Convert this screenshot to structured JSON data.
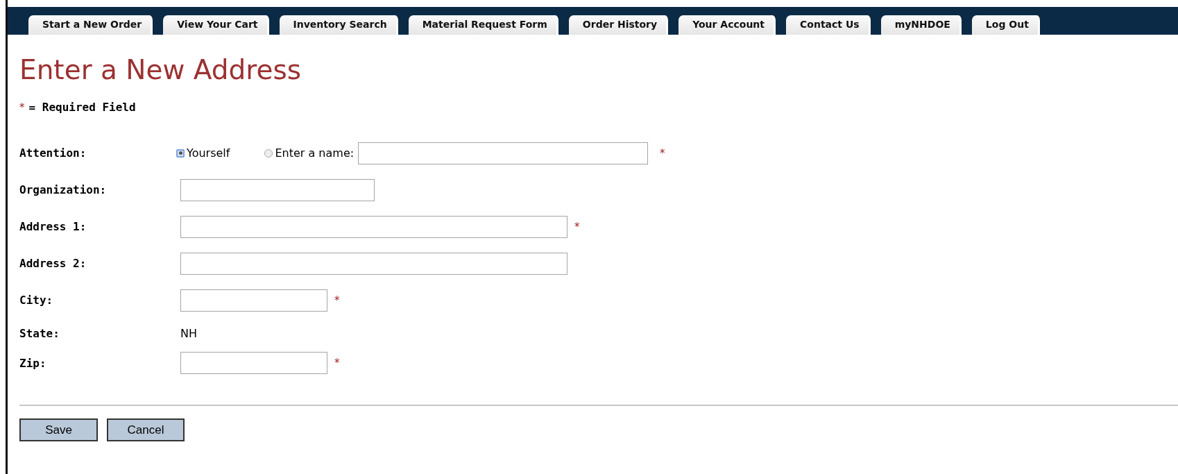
{
  "tabs": [
    {
      "label": "Start a New Order"
    },
    {
      "label": "View Your Cart"
    },
    {
      "label": "Inventory Search"
    },
    {
      "label": "Material Request Form"
    },
    {
      "label": "Order History"
    },
    {
      "label": "Your Account"
    },
    {
      "label": "Contact Us"
    },
    {
      "label": "myNHDOE"
    },
    {
      "label": "Log Out"
    }
  ],
  "title": "Enter a New Address",
  "legend": {
    "mark": "*",
    "text": "= Required Field"
  },
  "fields": [
    {
      "kind": "radio",
      "label": "Attention:",
      "options": [
        {
          "label": "Yourself",
          "selected": true
        },
        {
          "label": "Enter a name:",
          "selected": false
        }
      ],
      "required": true
    },
    {
      "kind": "text",
      "label": "Organization:",
      "required": false
    },
    {
      "kind": "text",
      "label": "Address 1:",
      "required": true
    },
    {
      "kind": "text",
      "label": "Address 2:",
      "required": false
    },
    {
      "kind": "text",
      "label": "City:",
      "required": true
    },
    {
      "kind": "static",
      "label": "State:",
      "value": "NH"
    },
    {
      "kind": "text",
      "label": "Zip:",
      "required": true
    }
  ],
  "required_mark": "*",
  "buttons": [
    {
      "label": "Save"
    },
    {
      "label": "Cancel"
    }
  ]
}
